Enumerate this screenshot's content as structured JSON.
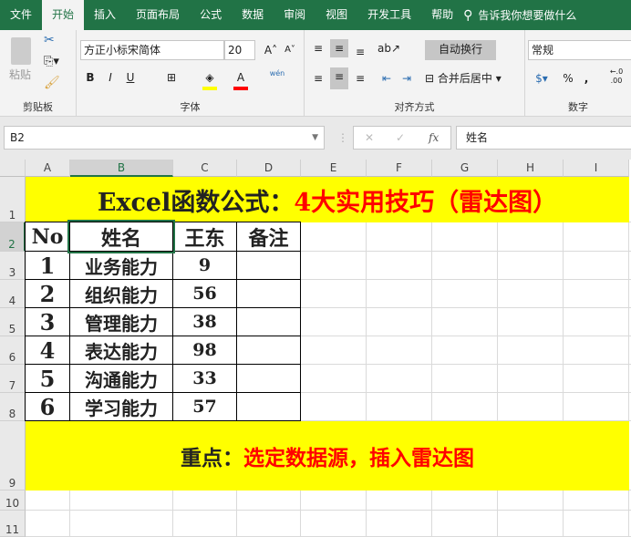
{
  "tabs": [
    "文件",
    "开始",
    "插入",
    "页面布局",
    "公式",
    "数据",
    "审阅",
    "视图",
    "开发工具",
    "帮助"
  ],
  "search": "告诉我你想要做什么",
  "ribbon": {
    "paste": "粘贴",
    "clipboard": "剪贴板",
    "font_name": "方正小标宋简体",
    "font_size": "20",
    "font_group": "字体",
    "wrap": "自动换行",
    "merge": "合并后居中",
    "align_group": "对齐方式",
    "number_format": "常规",
    "number_group": "数字",
    "bold": "B",
    "italic": "I",
    "underline": "U",
    "percent": "%",
    "comma": ",",
    "wen": "wén"
  },
  "formula": {
    "name_box": "B2",
    "content": "姓名",
    "fx": "fx"
  },
  "columns": [
    "A",
    "B",
    "C",
    "D",
    "E",
    "F",
    "G",
    "H",
    "I"
  ],
  "rows": [
    "1",
    "2",
    "3",
    "4",
    "5",
    "6",
    "7",
    "8",
    "9",
    "10",
    "11"
  ],
  "title": {
    "black": "Excel函数公式：",
    "red": "4大实用技巧（雷达图）"
  },
  "table": {
    "headers": [
      "No",
      "姓名",
      "王东",
      "备注"
    ],
    "rows": [
      [
        "1",
        "业务能力",
        "9",
        ""
      ],
      [
        "2",
        "组织能力",
        "56",
        ""
      ],
      [
        "3",
        "管理能力",
        "38",
        ""
      ],
      [
        "4",
        "表达能力",
        "98",
        ""
      ],
      [
        "5",
        "沟通能力",
        "33",
        ""
      ],
      [
        "6",
        "学习能力",
        "57",
        ""
      ]
    ]
  },
  "note": {
    "black": "重点：",
    "red": "选定数据源，插入雷达图"
  }
}
